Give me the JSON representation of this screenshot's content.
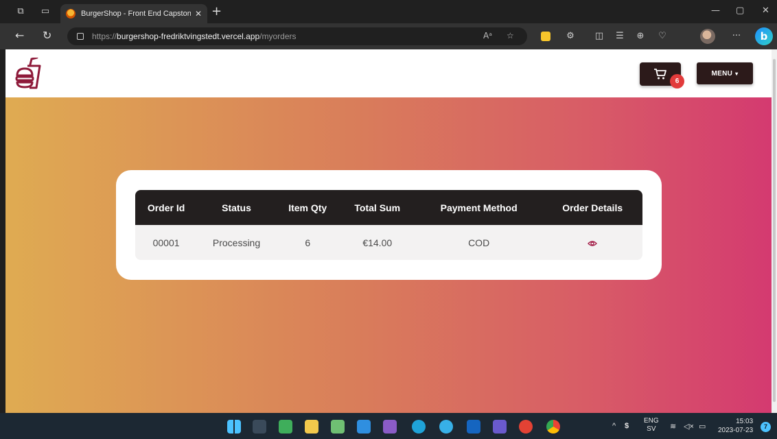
{
  "browser": {
    "tab_title": "BurgerShop - Front End Capstone",
    "new_tab_glyph": "+",
    "url_prefix": "https://",
    "url_host": "burgershop-fredriktvingstedt.vercel.app",
    "url_path": "/myorders",
    "read_aloud_glyph": "Aᵃ",
    "more_glyph": "···"
  },
  "header": {
    "cart_count": "6",
    "menu_label": "MENU",
    "menu_caret": "▾"
  },
  "orders": {
    "columns": [
      "Order Id",
      "Status",
      "Item Qty",
      "Total Sum",
      "Payment Method",
      "Order Details"
    ],
    "rows": [
      {
        "order_id": "00001",
        "status": "Processing",
        "item_qty": "6",
        "total_sum": "€14.00",
        "payment_method": "COD"
      }
    ]
  },
  "taskbar": {
    "lang_top": "ENG",
    "lang_bottom": "SV",
    "time": "15:03",
    "date": "2023-07-23",
    "notification_count": "7"
  },
  "colors": {
    "gradient_start": "#dfab52",
    "gradient_end": "#d43a70",
    "header_dark": "#231f1f",
    "accent": "#a4204a",
    "badge_red": "#e23b3b"
  },
  "icons": [
    "workspaces-icon",
    "tab-actions-icon",
    "back-icon",
    "refresh-icon",
    "lock-icon",
    "favorite-icon",
    "cart-icon",
    "eye-icon",
    "burger-logo-icon"
  ]
}
